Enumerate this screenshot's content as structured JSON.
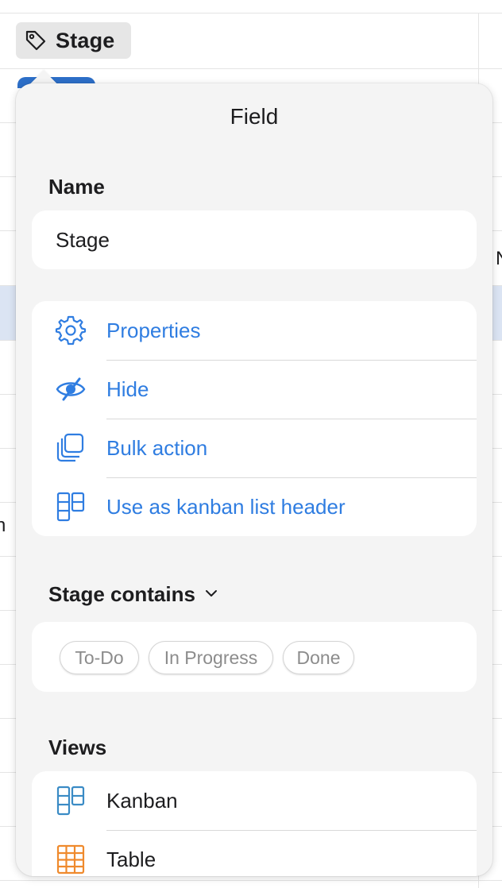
{
  "header": {
    "column_label": "Stage",
    "column_icon": "tag-icon",
    "edge_glyphs": [
      "N",
      "n"
    ]
  },
  "popover": {
    "title": "Field",
    "name_section": {
      "label": "Name",
      "value": "Stage"
    },
    "actions": [
      {
        "label": "Properties",
        "icon": "gear-icon"
      },
      {
        "label": "Hide",
        "icon": "eye-slash-icon"
      },
      {
        "label": "Bulk action",
        "icon": "stacked-squares-icon"
      },
      {
        "label": "Use as kanban list header",
        "icon": "kanban-icon"
      }
    ],
    "stage_contains": {
      "label": "Stage contains",
      "values": [
        "To-Do",
        "In Progress",
        "Done"
      ]
    },
    "views": {
      "label": "Views",
      "items": [
        {
          "label": "Kanban",
          "icon": "kanban-icon"
        },
        {
          "label": "Table",
          "icon": "table-icon"
        }
      ]
    }
  },
  "colors": {
    "accent": "#2f7de1",
    "popover_bg": "#f4f4f4",
    "selected_row": "#dbe4f3",
    "kanban_view_icon": "#3a8bc5",
    "table_view_icon": "#ef8a2d"
  }
}
